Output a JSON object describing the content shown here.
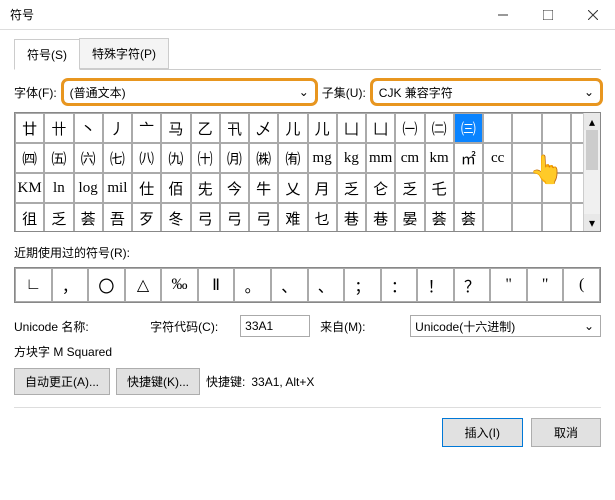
{
  "window": {
    "title": "符号"
  },
  "tabs": {
    "t0": "符号(S)",
    "t1": "特殊字符(P)"
  },
  "font": {
    "label": "字体(F):",
    "value": "(普通文本)"
  },
  "subset": {
    "label": "子集(U):",
    "value": "CJK 兼容字符"
  },
  "grid": [
    "廿",
    "卄",
    "丶",
    "丿",
    "亠",
    "马",
    "乙",
    "卂",
    "乄",
    "儿",
    "儿",
    "凵",
    "凵",
    "㈠",
    "㈡",
    "㈢",
    "",
    "",
    "",
    "",
    "㈣",
    "㈤",
    "㈥",
    "㈦",
    "㈧",
    "㈨",
    "㈩",
    "㈪",
    "㈱",
    "㈲",
    "mg",
    "kg",
    "mm",
    "cm",
    "km",
    "㎡",
    "cc",
    "",
    "",
    "",
    "KM",
    "ln",
    "log",
    "mil",
    "仕",
    "佰",
    "兂",
    "今",
    "牛",
    "乂",
    "月",
    "乏",
    "仑",
    "乏",
    "乇",
    "",
    "",
    "",
    "",
    "",
    "徂",
    "乏",
    "荟",
    "吾",
    "歹",
    "冬",
    "弓",
    "弓",
    "弓",
    "难",
    "乜",
    "巷",
    "巷",
    "晏",
    "荟",
    "荟",
    "",
    "",
    "",
    ""
  ],
  "selected_index": 15,
  "recent": {
    "label": "近期使用过的符号(R):",
    "items": [
      "∟",
      "，",
      "〇",
      "△",
      "‰",
      "Ⅱ",
      "。",
      "、",
      "、",
      "；",
      "：",
      "！",
      "？",
      "\"",
      "\"",
      "("
    ]
  },
  "unicode_name": {
    "label": "Unicode 名称:",
    "value": "方块字 M Squared"
  },
  "char_code": {
    "label": "字符代码(C):",
    "value": "33A1"
  },
  "from": {
    "label": "来自(M):",
    "value": "Unicode(十六进制)"
  },
  "buttons": {
    "autocorrect": "自动更正(A)...",
    "shortcut": "快捷键(K)...",
    "insert": "插入(I)",
    "cancel": "取消"
  },
  "shortcut_text": {
    "label": "快捷键: ",
    "value": "33A1, Alt+X"
  }
}
